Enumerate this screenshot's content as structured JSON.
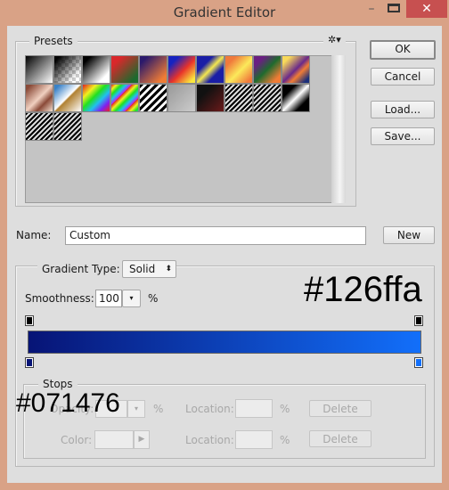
{
  "window": {
    "title": "Gradient Editor",
    "minimize": "–",
    "close": "✕"
  },
  "presets": {
    "label": "Presets",
    "menu_icon": "gear-icon",
    "menu_glyph": "✲▾",
    "swatches": [
      "linear-gradient(135deg,#000,#fff)",
      "linear-gradient(135deg,#000 10%,rgba(255,255,255,0) 80%)",
      "linear-gradient(135deg,#000 15%,#fff 80%)",
      "linear-gradient(135deg,#d9282b 20%,#1c6a2d 85%)",
      "linear-gradient(135deg,#2b1a6b 15%,#f07c35 85%)",
      "linear-gradient(135deg,#1623c0 20%,#e8332a 55%,#fbe93d 90%)",
      "linear-gradient(135deg,#1a1ea6 30%,#f4e850 50%,#1a1ea6 70%)",
      "linear-gradient(135deg,#f07a3c 20%,#fbe95a 55%,#f07a3c 90%)",
      "linear-gradient(135deg,#6a1f82 20%,#1f6a2e 50%,#f07c35 85%)",
      "linear-gradient(135deg,#f8d95a 15%,#6a2a8a 50%,#f07c35 65%,#1b2f7a 90%)",
      "linear-gradient(135deg,#8a4a38 10%,#f0d0c0 50%,#8a4a38 70%,#f4e0d0)",
      "linear-gradient(135deg,#3a82c8 10%,#fff 48%,#b08030 52%,#fff)",
      "linear-gradient(135deg,#e02020,#f0f020 25%,#20e020,#20c0f0,#8020f0,#f02020)",
      "repeating-linear-gradient(135deg,#e02020 0,#f0f020 4px,#20e020 8px,#20c0f0 12px,#c020f0 16px)",
      "repeating-linear-gradient(135deg,#000 0,#000 3px,#fff 3px,#fff 6px)",
      "linear-gradient(135deg,#999,#ccc)",
      "linear-gradient(135deg,#111 30%,#6b1a1a)",
      "repeating-linear-gradient(135deg,#000 0,#000 2px,#ddd 2px,#ddd 4px)",
      "repeating-linear-gradient(135deg,#000 0,#000 2px,#ddd 2px,#ddd 4px)",
      "linear-gradient(135deg,#000 25%,#fff 50%,#000 75%)",
      "repeating-linear-gradient(135deg,#000 0,#000 2px,#ddd 2px,#ddd 4px)",
      "repeating-linear-gradient(135deg,#000 0,#000 2px,#ddd 2px,#ddd 4px)"
    ]
  },
  "buttons": {
    "ok": "OK",
    "cancel": "Cancel",
    "load": "Load...",
    "save": "Save...",
    "new": "New"
  },
  "name": {
    "label": "Name:",
    "value": "Custom"
  },
  "gradient_type": {
    "label": "Gradient Type:",
    "value": "Solid",
    "arrow": "⬍"
  },
  "smoothness": {
    "label": "Smoothness:",
    "value": "100",
    "unit": "%",
    "arrow": "▾"
  },
  "gradient": {
    "start_color": "#071476",
    "end_color": "#126ffa",
    "opacity_stop_color": "#000000"
  },
  "stops": {
    "label": "Stops",
    "opacity_label": "Opacity:",
    "opacity_unit": "%",
    "color_label": "Color:",
    "location_label": "Location:",
    "location_unit": "%",
    "delete": "Delete",
    "arrow": "▾",
    "color_arrow": "▶"
  },
  "annotations": {
    "end_hex": "#126ffa",
    "start_hex": "#071476"
  }
}
